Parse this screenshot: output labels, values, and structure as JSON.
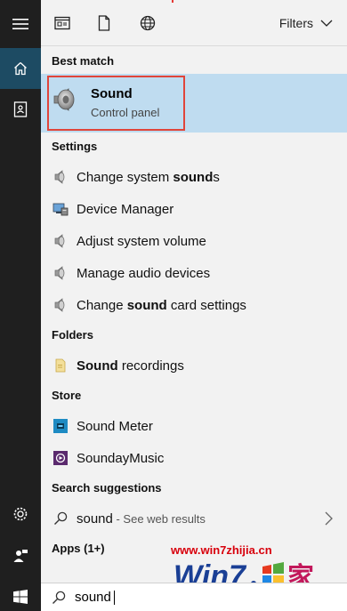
{
  "topbar": {
    "filters_label": "Filters"
  },
  "sections": {
    "best_match": "Best match",
    "settings": "Settings",
    "folders": "Folders",
    "store": "Store",
    "search_suggestions": "Search suggestions",
    "apps": "Apps (1+)"
  },
  "best_match": {
    "title": "Sound",
    "subtitle": "Control panel",
    "icon": "speaker-icon"
  },
  "settings": [
    {
      "pre": "Change system ",
      "bold": "sound",
      "post": "s",
      "icon": "speaker-icon"
    },
    {
      "pre": "Device Manager",
      "bold": "",
      "post": "",
      "icon": "device-manager-icon"
    },
    {
      "pre": "Adjust system volume",
      "bold": "",
      "post": "",
      "icon": "speaker-icon"
    },
    {
      "pre": "Manage audio devices",
      "bold": "",
      "post": "",
      "icon": "speaker-icon"
    },
    {
      "pre": "Change ",
      "bold": "sound",
      "post": " card settings",
      "icon": "speaker-icon"
    }
  ],
  "folders": [
    {
      "pre": "",
      "bold": "Sound",
      "post": " recordings",
      "icon": "folder-icon"
    }
  ],
  "store": [
    {
      "label": "Sound Meter",
      "icon": "sound-meter-app-icon"
    },
    {
      "label": "SoundayMusic",
      "icon": "sounday-music-app-icon"
    }
  ],
  "suggestion": {
    "query": "sound",
    "suffix": " - See web results"
  },
  "search": {
    "value": "sound"
  },
  "watermark": {
    "url": "www.win7zhijia.cn"
  },
  "colors": {
    "rail": "#1f1f1f",
    "rail_active": "#1d4b63",
    "highlight": "#bfdcf0",
    "outline": "#e0453a",
    "watermark": "#d8000c"
  }
}
